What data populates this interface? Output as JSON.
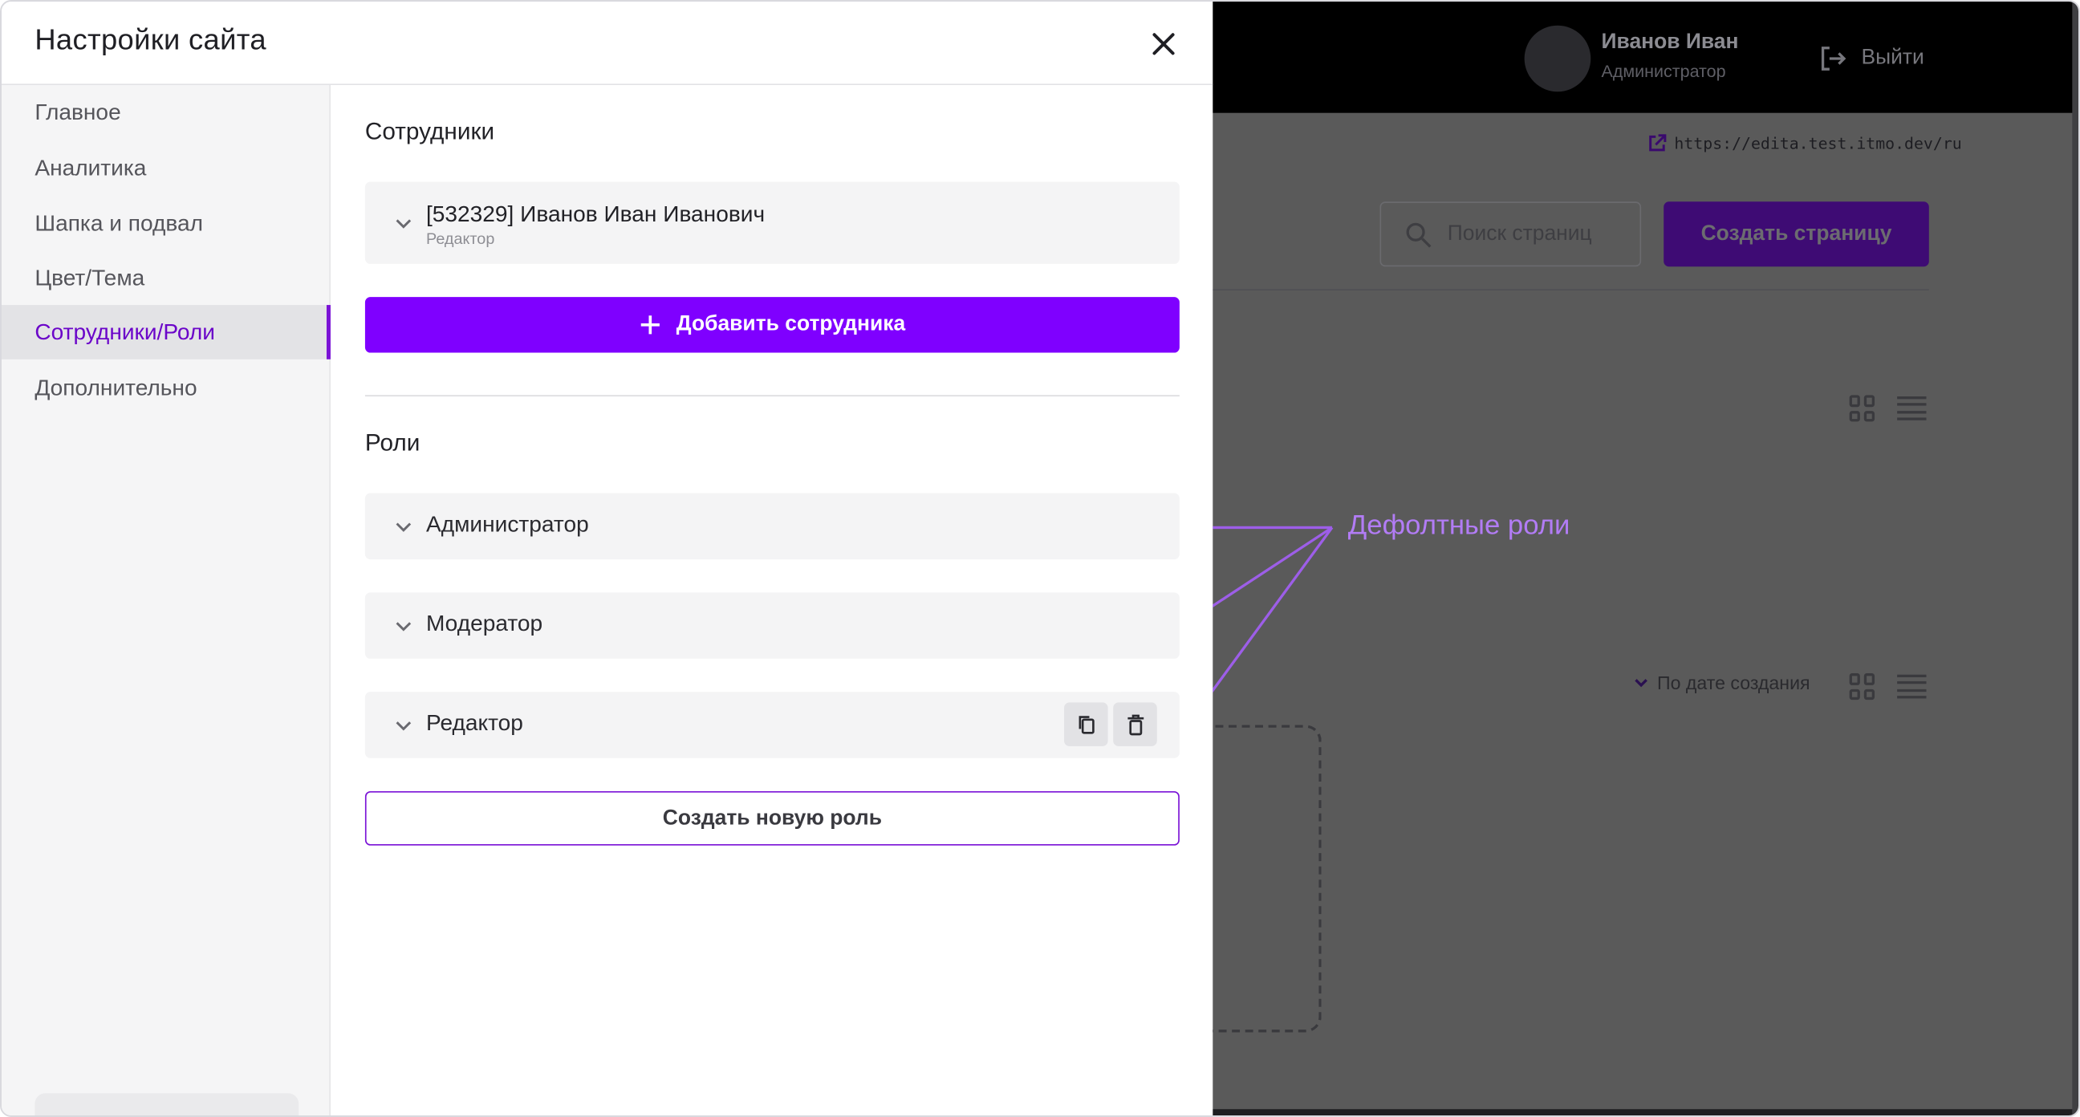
{
  "modal": {
    "title": "Настройки сайта",
    "close_icon": "close-icon"
  },
  "sidebar": {
    "items": [
      {
        "label": "Главное",
        "active": false
      },
      {
        "label": "Аналитика",
        "active": false
      },
      {
        "label": "Шапка и подвал",
        "active": false
      },
      {
        "label": "Цвет/Тема",
        "active": false
      },
      {
        "label": "Сотрудники/Роли",
        "active": true
      },
      {
        "label": "Дополнительно",
        "active": false
      }
    ]
  },
  "employees": {
    "title": "Сотрудники",
    "list": [
      {
        "name": "[532329] Иванов Иван Иванович",
        "role": "Редактор"
      }
    ],
    "add_button": "Добавить сотрудника"
  },
  "roles": {
    "title": "Роли",
    "list": [
      {
        "label": "Администратор"
      },
      {
        "label": "Модератор"
      },
      {
        "label": "Редактор"
      }
    ],
    "copy_icon": "copy-icon",
    "delete_icon": "trash-icon",
    "create_button": "Создать новую роль"
  },
  "annotation": {
    "text": "Дефолтные роли",
    "color": "#b27cf5"
  },
  "background_app": {
    "user_name": "Иванов Иван",
    "user_role": "Администратор",
    "logout_label": "Выйти",
    "site_url": "https://edita.test.itmo.dev/ru",
    "search_placeholder": "Поиск страниц",
    "create_page_label": "Создать страницу",
    "sort_label": "По дате создания"
  },
  "colors": {
    "accent": "#7f00ff",
    "active_text": "#6b06c9",
    "overlay": "#5a5a5a"
  }
}
